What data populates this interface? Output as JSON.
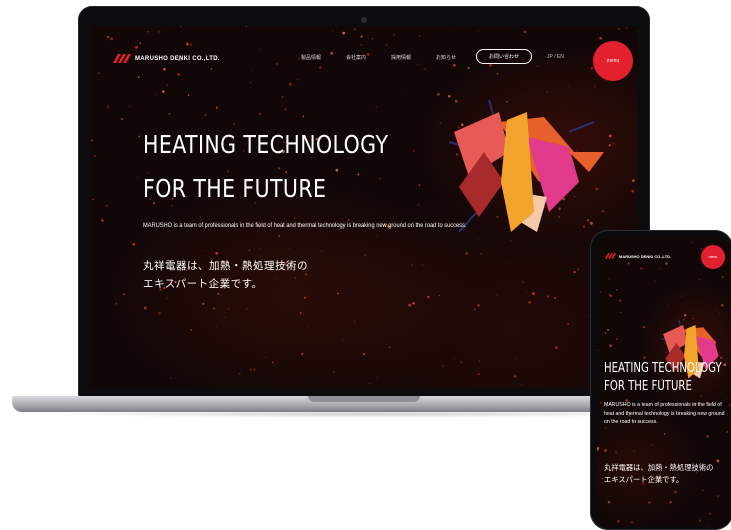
{
  "laptop": {
    "logo_text": "MARUSHO DENKI CO.,LTD.",
    "nav": [
      "製品情報",
      "会社案内",
      "採用情報",
      "お知らせ"
    ],
    "contact_label": "お問い合わせ",
    "lang_label": "JP / EN",
    "menu_label": "menu",
    "hero_title_line1": "HEATING TECHNOLOGY",
    "hero_title_line2": "FOR THE FUTURE",
    "hero_subtitle": "MARUSHO is a team of professionals in the field of heat and thermal technology is breaking new ground on the road to success.",
    "hero_jp_line1": "丸祥電器は、加熱・熱処理技術の",
    "hero_jp_line2": "エキスパート企業です。"
  },
  "phone": {
    "logo_text": "MARUSHO DENKI CO.,LTD.",
    "menu_label": "menu",
    "hero_title_line1": "HEATING TECHNOLOGY",
    "hero_title_line2": "FOR THE FUTURE",
    "hero_subtitle": "MARUSHO is a team of professionals in the field of heat and thermal technology is breaking new ground on the road to success.",
    "hero_jp_line1": "丸祥電器は、加熱・熱処理技術の",
    "hero_jp_line2": "エキスパート企業です。"
  },
  "colors": {
    "brand_red": "#e3202e",
    "background": "#120707",
    "shape_orange": "#e85a30",
    "shape_yellow": "#f2a42c",
    "shape_pink": "#e23a8a",
    "shape_peach": "#f5c8a8",
    "shape_navy": "#2a2f6e"
  },
  "icons": [
    "marusho-logo-icon",
    "camera-icon"
  ]
}
